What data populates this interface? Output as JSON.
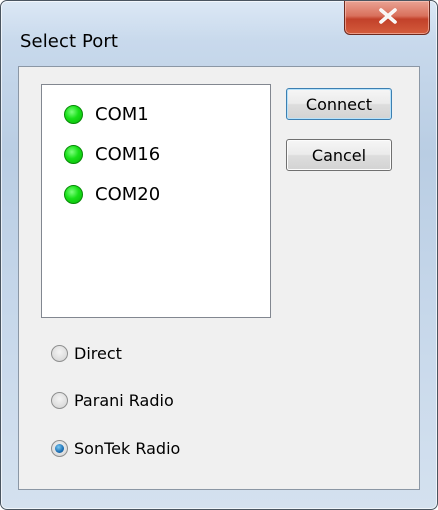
{
  "window": {
    "title": "Select Port",
    "close_glyph": "X"
  },
  "ports": [
    {
      "label": "COM1",
      "status_color": "#18e018"
    },
    {
      "label": "COM16",
      "status_color": "#18e018"
    },
    {
      "label": "COM20",
      "status_color": "#18e018"
    }
  ],
  "buttons": {
    "connect": "Connect",
    "cancel": "Cancel"
  },
  "radios": [
    {
      "label": "Direct",
      "checked": false
    },
    {
      "label": "Parani Radio",
      "checked": false
    },
    {
      "label": "SonTek Radio",
      "checked": true
    }
  ],
  "icons": {
    "close": "close-icon",
    "port_status": "status-dot-icon",
    "radio": "radio-button-icon"
  }
}
